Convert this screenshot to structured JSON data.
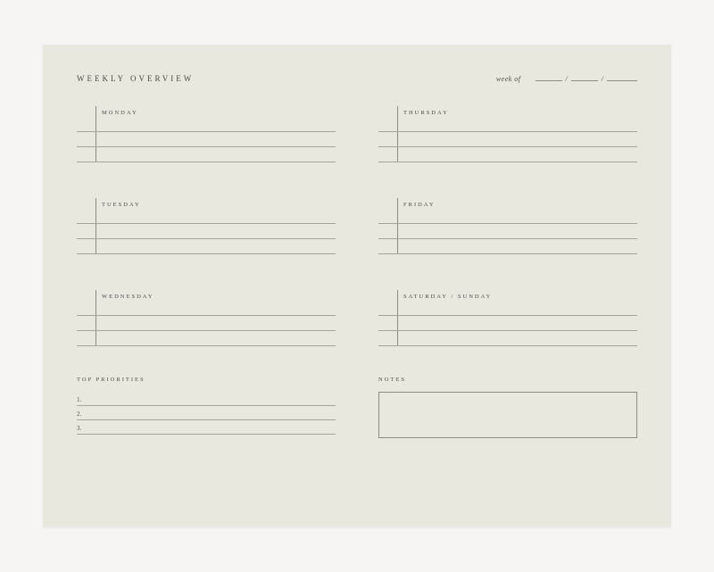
{
  "header": {
    "title": "WEEKLY OVERVIEW",
    "week_of_label": "week of",
    "slash": "/"
  },
  "days": {
    "mon": "MONDAY",
    "tue": "TUESDAY",
    "wed": "WEDNESDAY",
    "thu": "THURSDAY",
    "fri": "FRIDAY",
    "weekend": "SATURDAY / SUNDAY"
  },
  "priorities": {
    "label": "TOP PRIORITIES",
    "n1": "1.",
    "n2": "2.",
    "n3": "3."
  },
  "notes": {
    "label": "NOTES"
  }
}
